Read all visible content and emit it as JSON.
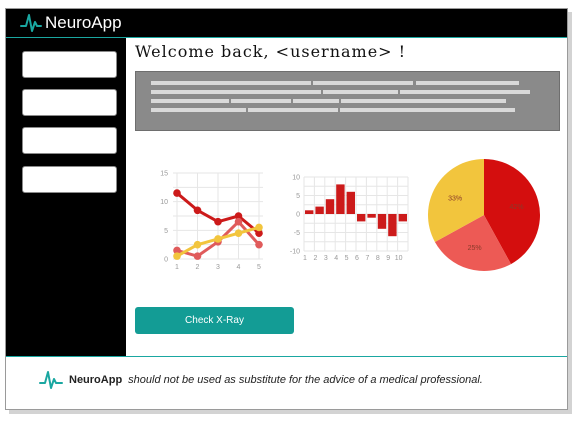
{
  "header": {
    "brand_name": "NeuroApp",
    "logo_icon": "neuro-pulse-icon",
    "accent_color": "#1aa7a1"
  },
  "sidebar": {
    "items": [
      {
        "label": ""
      },
      {
        "label": ""
      },
      {
        "label": ""
      },
      {
        "label": ""
      }
    ]
  },
  "main": {
    "welcome": "Welcome back, <username> !",
    "primary_button": "Check X-Ray",
    "button_color": "#139c95"
  },
  "chart_data": [
    {
      "type": "line",
      "x": [
        1,
        2,
        3,
        4,
        5
      ],
      "ylim": [
        0,
        15
      ],
      "yticks": [
        0,
        5,
        10,
        15
      ],
      "series": [
        {
          "color": "#cc1a1a",
          "values": [
            11.5,
            8.5,
            6.5,
            7.5,
            4.5
          ]
        },
        {
          "color": "#e05b5b",
          "values": [
            1.5,
            0.5,
            3,
            6.5,
            2.5
          ]
        },
        {
          "color": "#f2c53d",
          "values": [
            0.5,
            2.5,
            3.5,
            4.5,
            5.5
          ]
        }
      ]
    },
    {
      "type": "bar",
      "categories": [
        1,
        2,
        3,
        4,
        5,
        6,
        7,
        8,
        9,
        10
      ],
      "ylim": [
        -10,
        10
      ],
      "yticks": [
        -10,
        -5,
        0,
        5,
        10
      ],
      "series": [
        {
          "color": "#cc1a1a",
          "values": [
            1,
            2,
            4,
            8,
            6,
            -2,
            -1,
            -4,
            -6,
            -2
          ]
        }
      ]
    },
    {
      "type": "pie",
      "slices": [
        {
          "value": 42,
          "label": "42%",
          "color": "#d40e0e"
        },
        {
          "value": 25,
          "label": "25%",
          "color": "#ed5a55"
        },
        {
          "value": 33,
          "label": "33%",
          "color": "#f2c53d"
        }
      ]
    }
  ],
  "footer": {
    "brand_name": "NeuroApp",
    "disclaimer": "should not be used as substitute for the advice of a medical professional."
  }
}
